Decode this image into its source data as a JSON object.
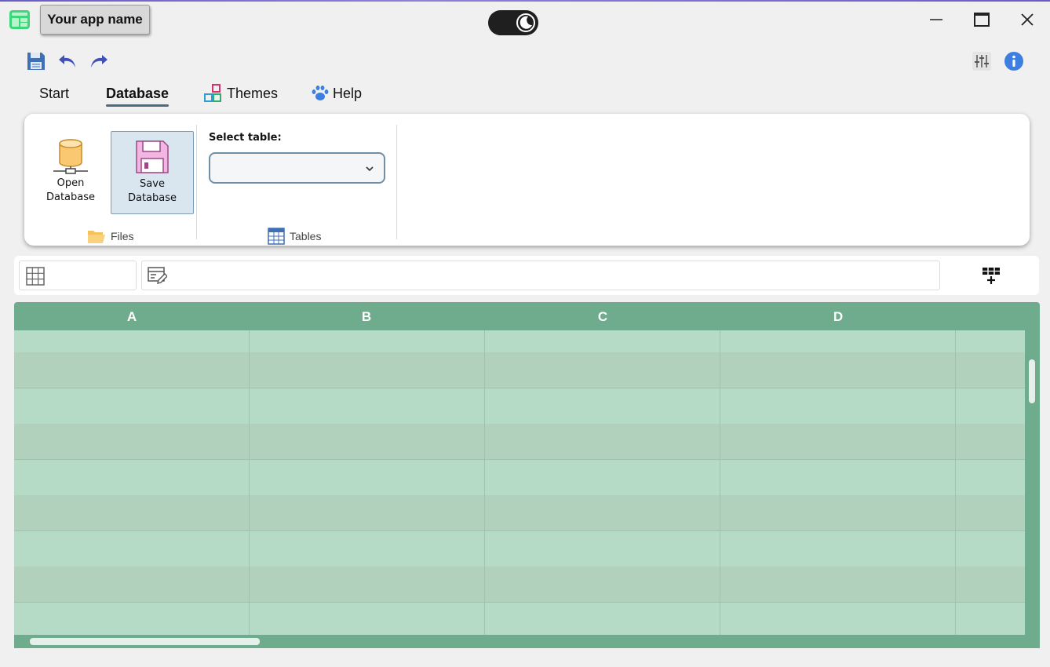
{
  "window": {
    "app_name": "Your app name",
    "icons": {
      "app": "app-icon",
      "theme_toggle": "moon-icon",
      "minimize": "minimize-icon",
      "maximize": "maximize-icon",
      "close": "close-icon"
    }
  },
  "quick_toolbar": {
    "icons": [
      "save-icon",
      "undo-icon",
      "redo-icon",
      "sliders-icon",
      "info-icon"
    ]
  },
  "tabs": [
    {
      "label": "Start",
      "selected": false
    },
    {
      "label": "Database",
      "selected": true
    },
    {
      "label": "Themes",
      "icon": "themes-icon",
      "selected": false
    },
    {
      "label": "Help",
      "icon": "paw-icon",
      "selected": false
    }
  ],
  "ribbon": {
    "files_group": {
      "label": "Files",
      "open_button": {
        "line1": "Open",
        "line2": "Database"
      },
      "save_button": {
        "line1": "Save",
        "line2": "Database"
      }
    },
    "tables_group": {
      "label": "Tables",
      "select_label": "Select table:",
      "select_value": ""
    }
  },
  "filter_bar": {
    "filter_value": ""
  },
  "sheet": {
    "columns": [
      "A",
      "B",
      "C",
      "D"
    ]
  },
  "colors": {
    "header_green": "#6fab8d",
    "row_light": "#b5dac6",
    "row_dark": "#b2d1bd",
    "accent_blue": "#3f51b5",
    "tab_underline": "#4a6b80"
  }
}
